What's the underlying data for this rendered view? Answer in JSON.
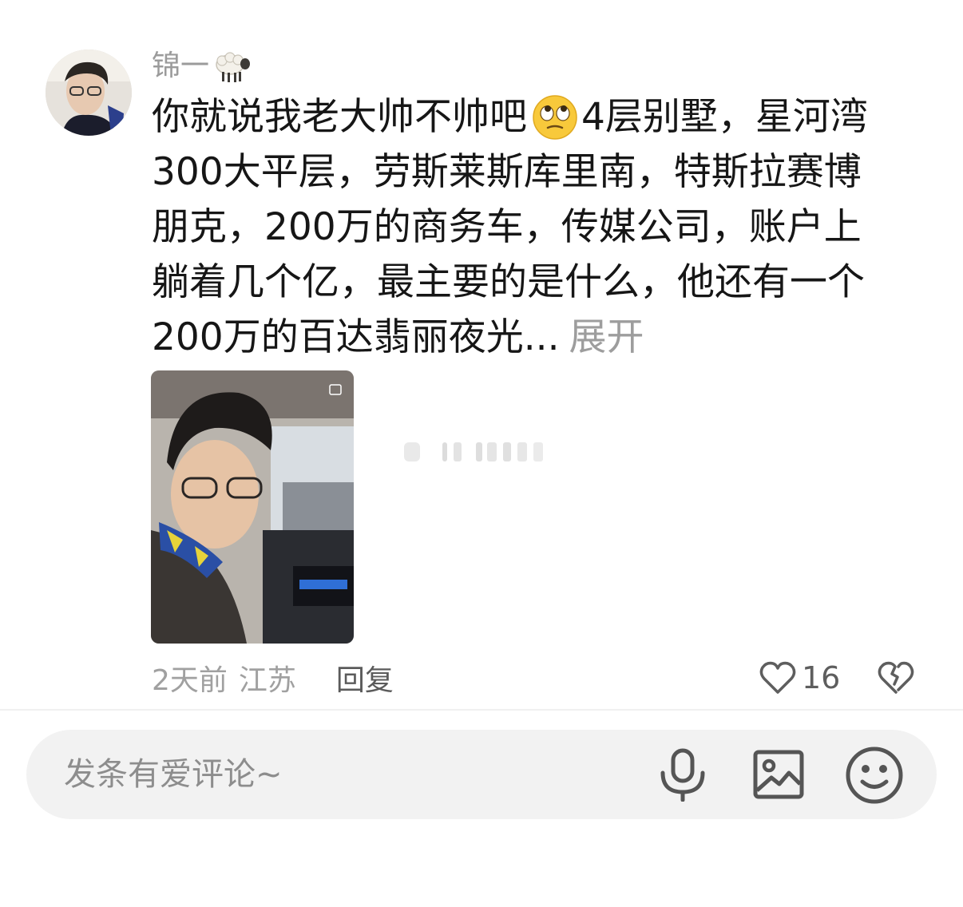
{
  "comment": {
    "username": "锦一",
    "username_emoji": "sheep-emoji",
    "text_lines": [
      "你就说我老大帅不帅吧",
      "4层别墅，星河湾",
      "300大平层，劳斯莱斯库里南，特斯拉赛博",
      "朋克，200万的商务车，传媒公司，账户上",
      "躺着几个亿，最主要的是什么，他还有一个",
      "200万的百达翡丽夜光..."
    ],
    "inline_emoji": "eye-roll-emoji",
    "expand_label": "展开",
    "time": "2天前",
    "location": "江苏",
    "reply_label": "回复",
    "like_count": "16"
  },
  "input": {
    "placeholder": "发条有爱评论~"
  },
  "icons": {
    "like": "heart-outline-icon",
    "dislike": "broken-heart-icon",
    "mic": "microphone-icon",
    "image": "image-icon",
    "emoji": "smiley-icon"
  },
  "colors": {
    "text": "#161616",
    "muted": "#9d9d9d",
    "input_bg": "#f2f2f2"
  }
}
